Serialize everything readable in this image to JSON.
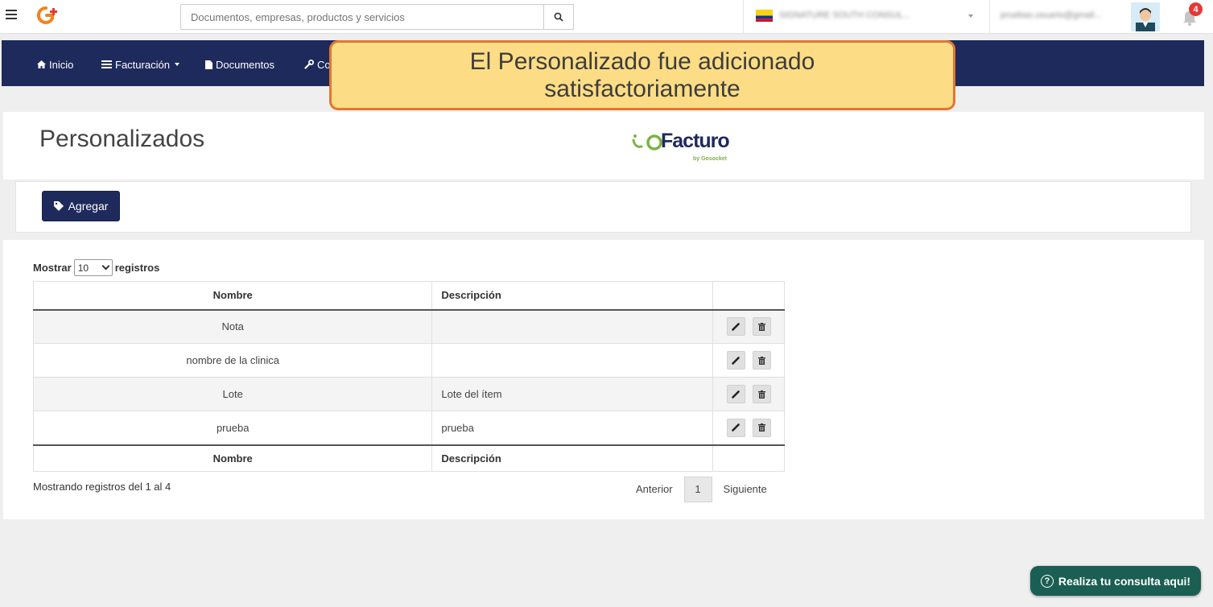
{
  "topbar": {
    "search_placeholder": "Documentos, empresas, productos y servicios",
    "company_name": "SIGNATURE SOUTH CONSUL...",
    "user_email": "pruebas.usuario@gmail...",
    "notification_count": "4"
  },
  "nav": {
    "items": [
      {
        "label": "Inicio",
        "icon": "home-icon"
      },
      {
        "label": "Facturación",
        "icon": "list-icon"
      },
      {
        "label": "Documentos",
        "icon": "document-icon"
      },
      {
        "label": "Co",
        "icon": "wrench-icon"
      }
    ]
  },
  "toast": {
    "message": "El Personalizado fue adicionado satisfactoriamente"
  },
  "header": {
    "title": "Personalizados",
    "logo_word": "Facturo",
    "logo_by": "by Gosocket"
  },
  "toolbar": {
    "add_label": "Agregar"
  },
  "table": {
    "length_prefix": "Mostrar",
    "length_value": "10",
    "length_suffix": "registros",
    "columns": [
      "Nombre",
      "Descripción",
      ""
    ],
    "rows": [
      {
        "nombre": "Nota",
        "descripcion": ""
      },
      {
        "nombre": "nombre de la clinica",
        "descripcion": ""
      },
      {
        "nombre": "Lote",
        "descripcion": "Lote del ítem"
      },
      {
        "nombre": "prueba",
        "descripcion": "prueba"
      }
    ],
    "info": "Mostrando registros del 1 al 4",
    "pagination": {
      "previous": "Anterior",
      "current": "1",
      "next": "Siguiente"
    }
  },
  "chat": {
    "label": "Realiza tu consulta aqui!"
  },
  "colors": {
    "navbar": "#1f2a5c",
    "toast_bg": "#fcdd85",
    "toast_border": "#e17732",
    "chat_bg": "#1b5e53",
    "logo_green": "#7cb342",
    "brand_orange": "#f5821f"
  }
}
